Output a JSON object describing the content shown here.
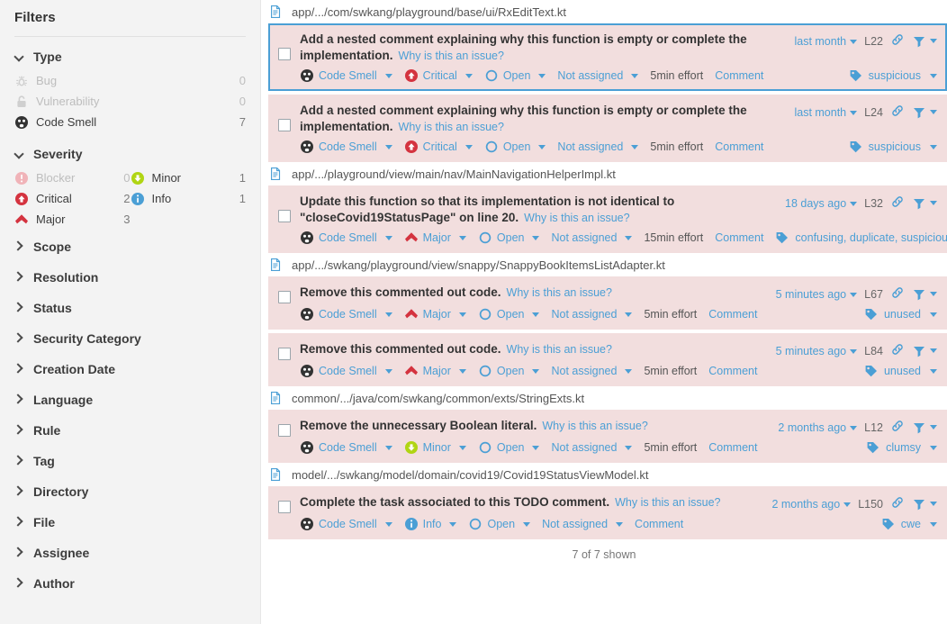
{
  "sidebar": {
    "title": "Filters",
    "facets": [
      {
        "name": "Type",
        "expanded": true,
        "icon": "chevron-down-icon",
        "items": [
          {
            "label": "Bug",
            "count": "0",
            "icon": "bug-icon",
            "disabled": true
          },
          {
            "label": "Vulnerability",
            "count": "0",
            "icon": "vulnerability-icon",
            "disabled": true
          },
          {
            "label": "Code Smell",
            "count": "7",
            "icon": "code-smell-icon",
            "disabled": false
          }
        ]
      },
      {
        "name": "Severity",
        "expanded": true,
        "icon": "chevron-down-icon",
        "left": [
          {
            "label": "Blocker",
            "count": "0",
            "icon": "severity-blocker-icon",
            "disabled": true
          },
          {
            "label": "Critical",
            "count": "2",
            "icon": "severity-critical-icon",
            "disabled": false
          },
          {
            "label": "Major",
            "count": "3",
            "icon": "severity-major-icon",
            "disabled": false
          }
        ],
        "right": [
          {
            "label": "Minor",
            "count": "1",
            "icon": "severity-minor-icon",
            "disabled": false
          },
          {
            "label": "Info",
            "count": "1",
            "icon": "severity-info-icon",
            "disabled": false
          }
        ]
      }
    ],
    "collapsed_facets": [
      {
        "label": "Scope"
      },
      {
        "label": "Resolution"
      },
      {
        "label": "Status"
      },
      {
        "label": "Security Category"
      },
      {
        "label": "Creation Date"
      },
      {
        "label": "Language"
      },
      {
        "label": "Rule"
      },
      {
        "label": "Tag"
      },
      {
        "label": "Directory"
      },
      {
        "label": "File"
      },
      {
        "label": "Assignee"
      },
      {
        "label": "Author"
      }
    ]
  },
  "main": {
    "why_link": "Why is this an issue?",
    "footer": "7 of 7 shown",
    "groups": [
      {
        "file": "app/.../com/swkang/playground/base/ui/RxEditText.kt",
        "issues": [
          {
            "selected": true,
            "message": "Add a nested comment explaining why this function is empty or complete the implementation.",
            "type": "Code Smell",
            "severity": "Critical",
            "severity_icon": "severity-critical-icon",
            "status": "Open",
            "assignee": "Not assigned",
            "effort": "5min effort",
            "comment": "Comment",
            "date": "last month",
            "line": "L22",
            "tags": "suspicious"
          },
          {
            "selected": false,
            "message": "Add a nested comment explaining why this function is empty or complete the implementation.",
            "type": "Code Smell",
            "severity": "Critical",
            "severity_icon": "severity-critical-icon",
            "status": "Open",
            "assignee": "Not assigned",
            "effort": "5min effort",
            "comment": "Comment",
            "date": "last month",
            "line": "L24",
            "tags": "suspicious"
          }
        ]
      },
      {
        "file": "app/.../playground/view/main/nav/MainNavigationHelperImpl.kt",
        "issues": [
          {
            "selected": false,
            "message": "Update this function so that its implementation is not identical to \"closeCovid19StatusPage\" on line 20.",
            "type": "Code Smell",
            "severity": "Major",
            "severity_icon": "severity-major-icon",
            "status": "Open",
            "assignee": "Not assigned",
            "effort": "15min effort",
            "comment": "Comment",
            "date": "18 days ago",
            "line": "L32",
            "tags": "confusing, duplicate, suspicious"
          }
        ]
      },
      {
        "file": "app/.../swkang/playground/view/snappy/SnappyBookItemsListAdapter.kt",
        "issues": [
          {
            "selected": false,
            "short": true,
            "message": "Remove this commented out code.",
            "type": "Code Smell",
            "severity": "Major",
            "severity_icon": "severity-major-icon",
            "status": "Open",
            "assignee": "Not assigned",
            "effort": "5min effort",
            "comment": "Comment",
            "date": "5 minutes ago",
            "line": "L67",
            "tags": "unused"
          },
          {
            "selected": false,
            "short": true,
            "message": "Remove this commented out code.",
            "type": "Code Smell",
            "severity": "Major",
            "severity_icon": "severity-major-icon",
            "status": "Open",
            "assignee": "Not assigned",
            "effort": "5min effort",
            "comment": "Comment",
            "date": "5 minutes ago",
            "line": "L84",
            "tags": "unused"
          }
        ]
      },
      {
        "file": "common/.../java/com/swkang/common/exts/StringExts.kt",
        "issues": [
          {
            "selected": false,
            "short": true,
            "message": "Remove the unnecessary Boolean literal.",
            "type": "Code Smell",
            "severity": "Minor",
            "severity_icon": "severity-minor-icon",
            "status": "Open",
            "assignee": "Not assigned",
            "effort": "5min effort",
            "comment": "Comment",
            "date": "2 months ago",
            "line": "L12",
            "tags": "clumsy"
          }
        ]
      },
      {
        "file": "model/.../swkang/model/domain/covid19/Covid19StatusViewModel.kt",
        "issues": [
          {
            "selected": false,
            "short": true,
            "message": "Complete the task associated to this TODO comment.",
            "type": "Code Smell",
            "severity": "Info",
            "severity_icon": "severity-info-icon",
            "status": "Open",
            "assignee": "Not assigned",
            "effort": "",
            "comment": "Comment",
            "date": "2 months ago",
            "line": "L150",
            "tags": "cwe"
          }
        ]
      }
    ]
  },
  "colors": {
    "accent": "#4b9fd5",
    "issue_bg": "#f2dede",
    "critical": "#d4333f",
    "major": "#d4333f",
    "minor": "#b0d513",
    "info": "#4b9fd5",
    "blocker": "#f0b3b8",
    "code_smell": "#333333"
  }
}
